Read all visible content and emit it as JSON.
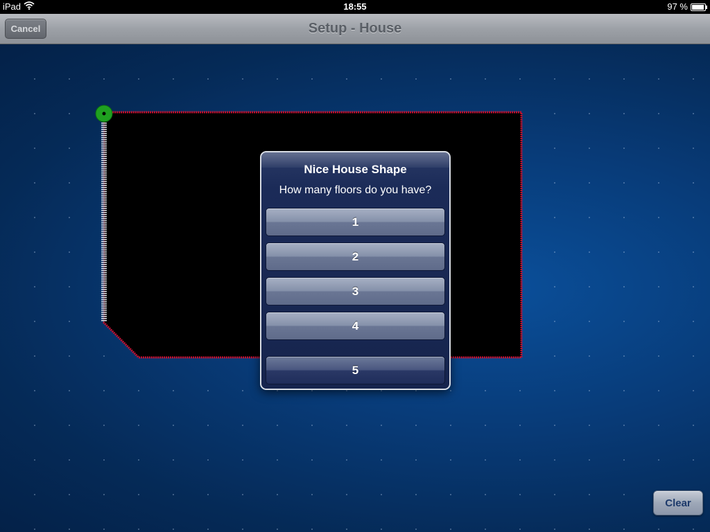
{
  "status_bar": {
    "device": "iPad",
    "time": "18:55",
    "battery_text": "97 %",
    "battery_level": 0.97
  },
  "nav": {
    "title": "Setup - House",
    "cancel_label": "Cancel"
  },
  "dialog": {
    "title": "Nice House Shape",
    "message": "How many floors do you have?",
    "options": [
      "1",
      "2",
      "3",
      "4",
      "5"
    ]
  },
  "toolbar": {
    "clear_label": "Clear"
  },
  "colors": {
    "outline": "#c8102e",
    "start_node": "#1fa020",
    "house_fill": "#000000"
  },
  "icons": {
    "wifi": "wifi-icon",
    "battery": "battery-icon"
  }
}
